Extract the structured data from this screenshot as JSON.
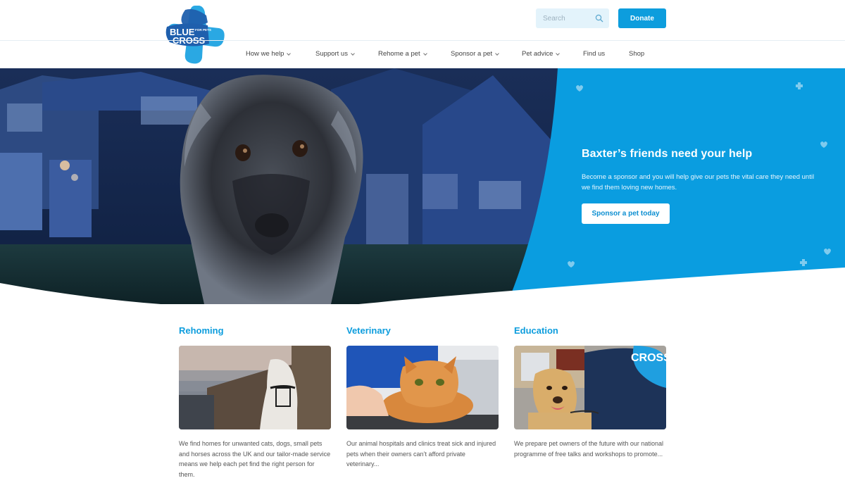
{
  "header": {
    "logo": {
      "line1": "BLUE",
      "line2": "CROSS",
      "tag": "FOR PETS"
    },
    "search": {
      "placeholder": "Search"
    },
    "donate_label": "Donate"
  },
  "nav": {
    "items": [
      {
        "label": "How we help",
        "has_dropdown": true
      },
      {
        "label": "Support us",
        "has_dropdown": true
      },
      {
        "label": "Rehome a pet",
        "has_dropdown": true
      },
      {
        "label": "Sponsor a pet",
        "has_dropdown": true
      },
      {
        "label": "Pet advice",
        "has_dropdown": true
      },
      {
        "label": "Find us",
        "has_dropdown": false
      },
      {
        "label": "Shop",
        "has_dropdown": false
      }
    ]
  },
  "hero": {
    "title": "Baxter’s friends need your help",
    "text": "Become a sponsor and you will help give our pets the vital care they need until we find them loving new homes.",
    "button_label": "Sponsor a pet today"
  },
  "cards": [
    {
      "title": "Rehoming",
      "text": "We find homes for unwanted cats, dogs, small pets and horses across the UK and our tailor-made service means we help each pet find the right person for them."
    },
    {
      "title": "Veterinary",
      "text": "Our animal hospitals and clinics treat sick and injured pets when their owners can’t afford private veterinary..."
    },
    {
      "title": "Education",
      "text": "We prepare pet owners of the future with our national programme of free talks and workshops to promote..."
    }
  ],
  "colors": {
    "brand_blue": "#0d9ddd",
    "logo_blue": "#1f5fad",
    "hero_panel": "#0a9de0"
  },
  "icons": [
    "search-icon",
    "chevron-down-icon",
    "heart-icon",
    "plus-icon"
  ]
}
